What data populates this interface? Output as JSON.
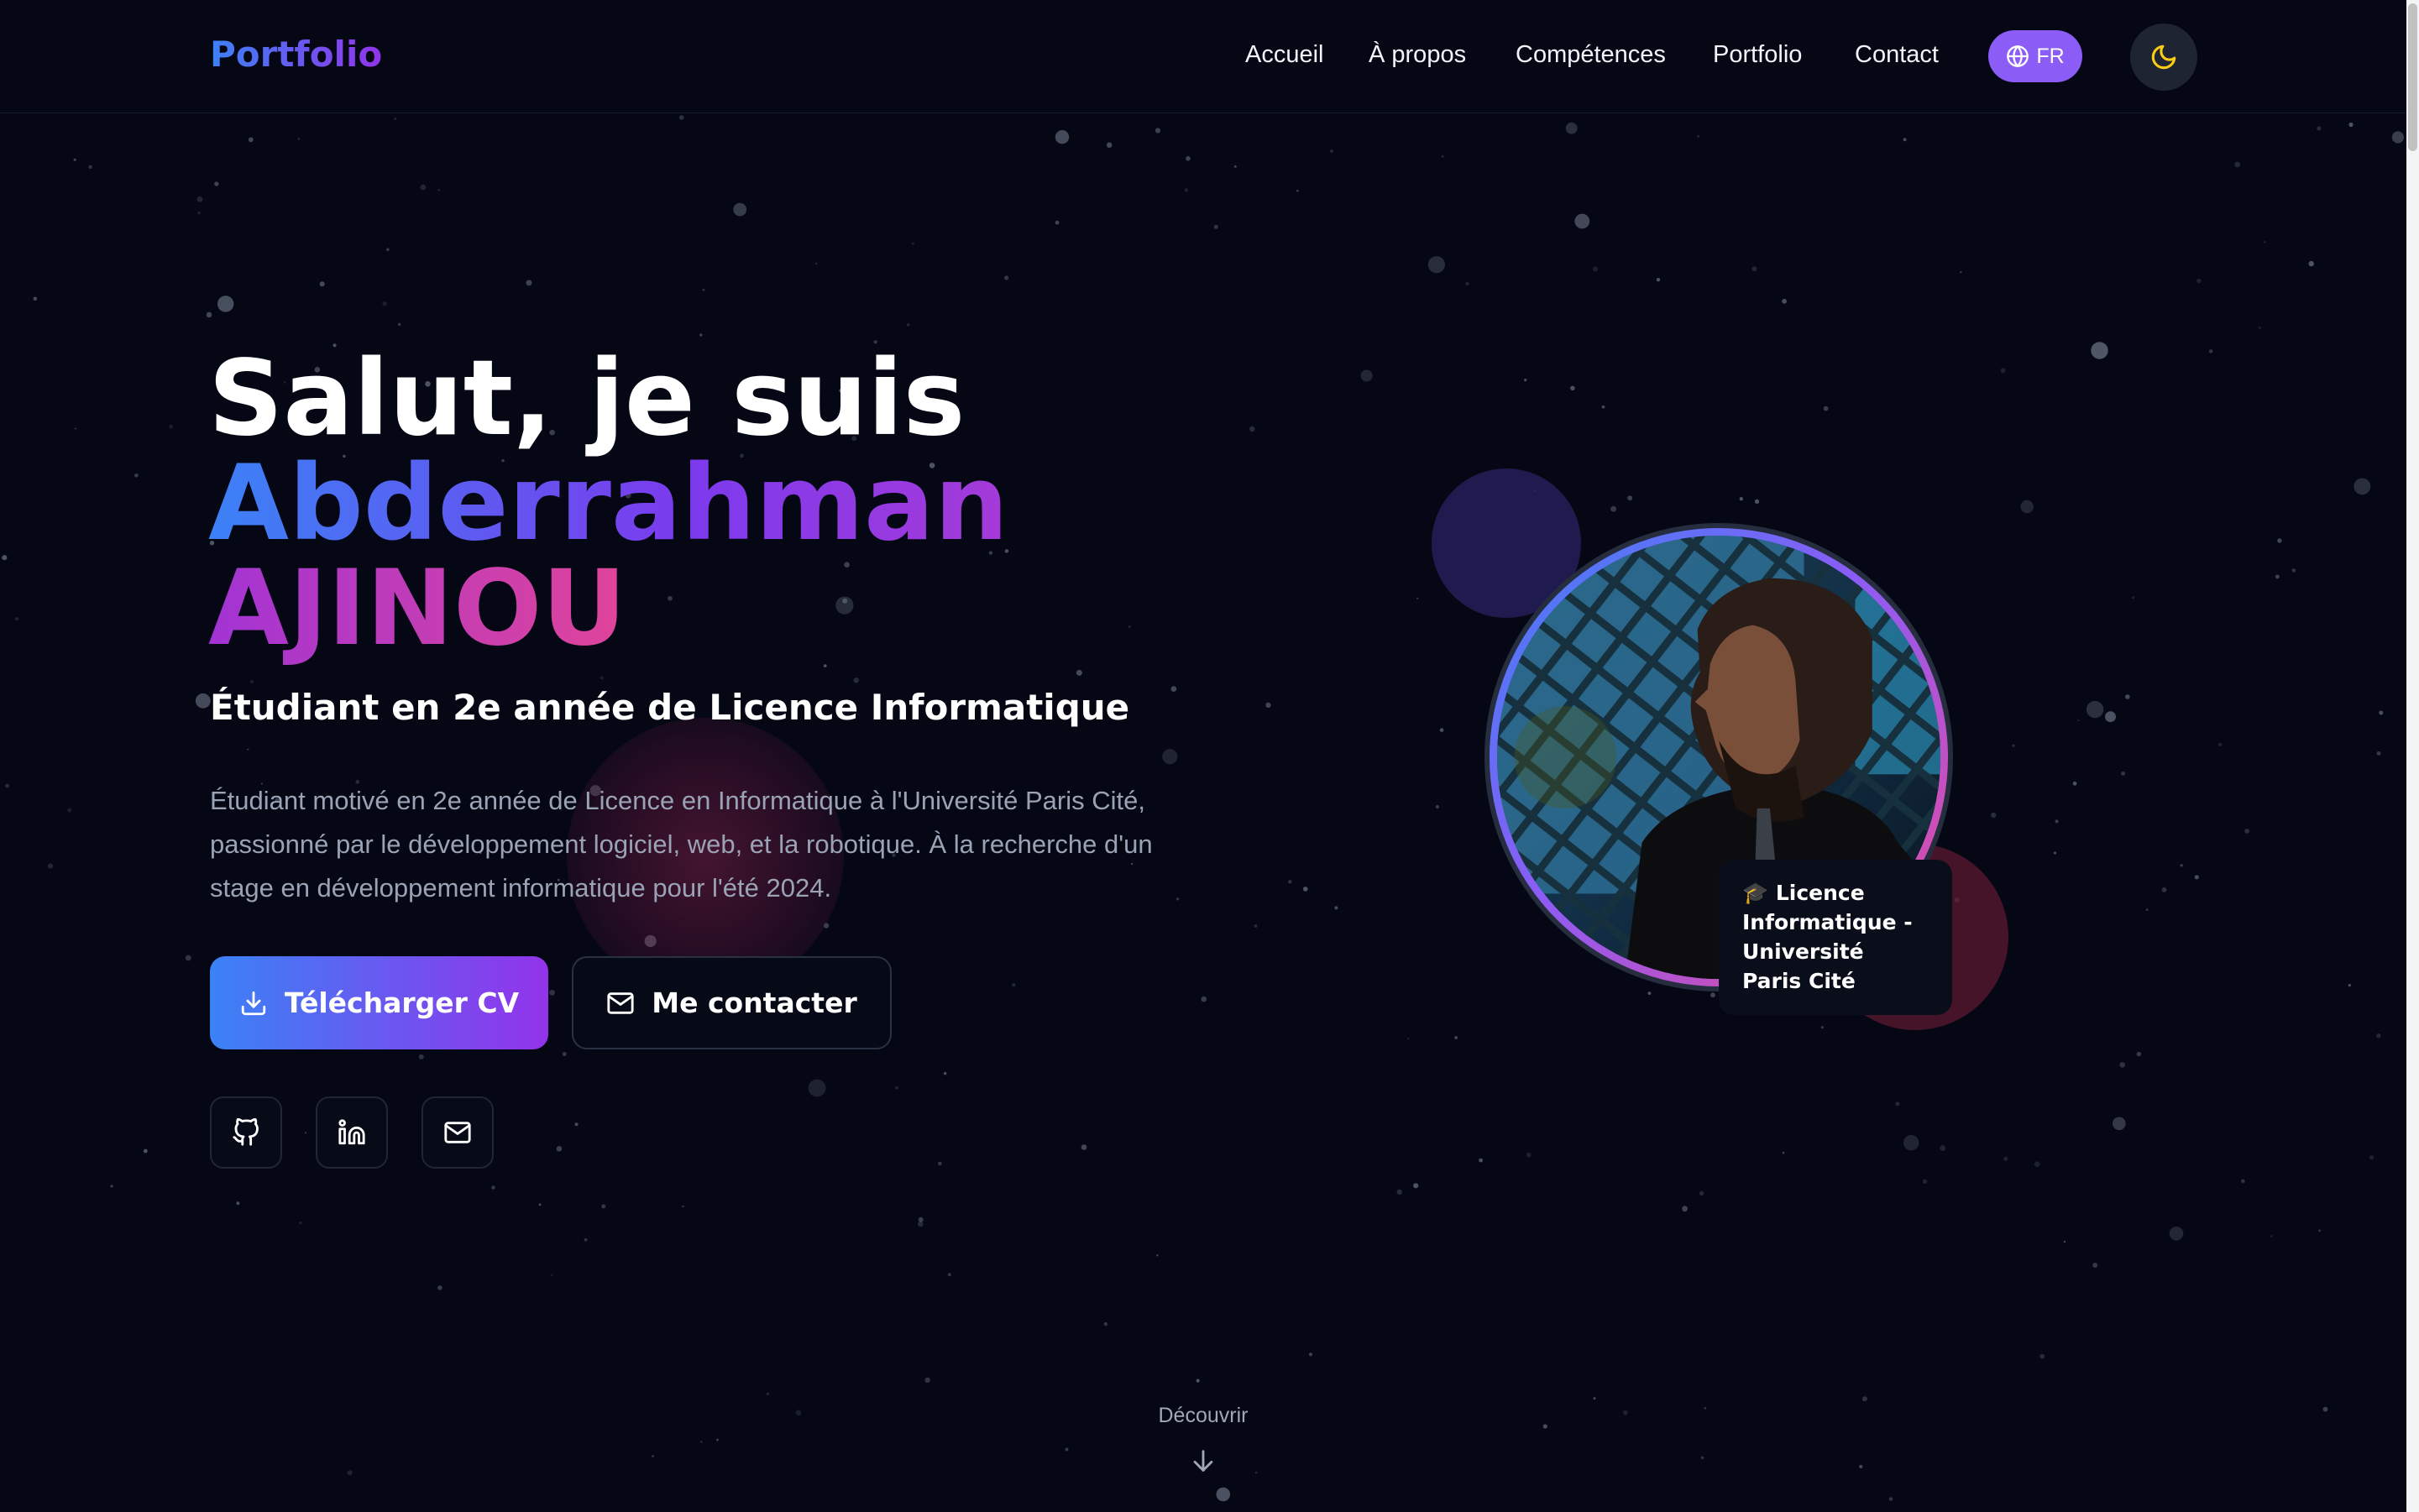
{
  "header": {
    "logo": "Portfolio",
    "nav": [
      "Accueil",
      "À propos",
      "Compétences",
      "Portfolio",
      "Contact"
    ],
    "language": "FR",
    "language_icon": "globe-icon",
    "theme_icon": "moon-icon"
  },
  "hero": {
    "greeting": "Salut, je suis",
    "name_first": "Abderrahman",
    "name_last": "AJINOU",
    "subtitle": "Étudiant en 2e année de Licence Informatique",
    "description": "Étudiant motivé en 2e année de Licence en Informatique à l'Université Paris Cité, passionné par le développement logiciel, web, et la robotique. À la recherche d'un stage en développement informatique pour l'été 2024.",
    "cta_download": "Télécharger CV",
    "cta_contact": "Me contacter",
    "social": [
      "github-icon",
      "linkedin-icon",
      "mail-icon"
    ]
  },
  "profile": {
    "badge_emoji": "🎓",
    "badge_text": "Licence Informatique - Université Paris Cité"
  },
  "scroll_hint": "Découvrir",
  "colors": {
    "background": "#050814",
    "accent_blue": "#3b82f6",
    "accent_purple": "#8b5cf6",
    "accent_pink": "#ec4899"
  }
}
